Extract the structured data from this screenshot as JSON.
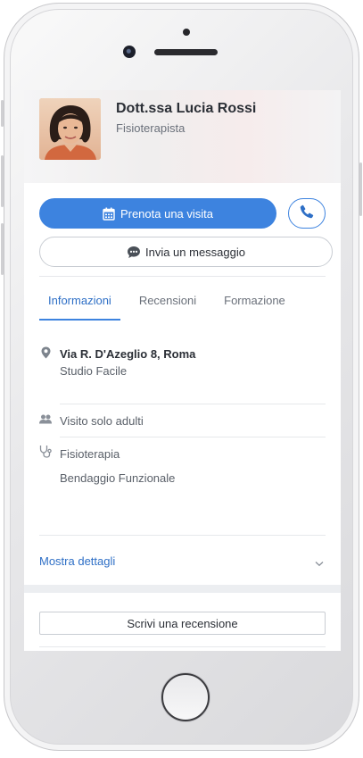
{
  "doctor": {
    "name": "Dott.ssa Lucia Rossi",
    "specialty": "Fisioterapista"
  },
  "actions": {
    "book_label": "Prenota una visita",
    "message_label": "Invia un messaggio",
    "call_icon": "phone-icon",
    "book_icon": "calendar-icon",
    "message_icon": "chat-bubble-icon"
  },
  "tabs": [
    {
      "label": "Informazioni",
      "active": true
    },
    {
      "label": "Recensioni",
      "active": false
    },
    {
      "label": "Formazione",
      "active": false
    }
  ],
  "info": {
    "address": "Via R. D'Azeglio 8, Roma",
    "clinic": "Studio Facile",
    "patients": "Visito solo adulti",
    "services": [
      "Fisioterapia",
      "Bendaggio Funzionale"
    ],
    "details_label": "Mostra dettagli"
  },
  "review": {
    "button_label": "Scrivi una recensione"
  },
  "colors": {
    "accent": "#3d83df",
    "link": "#2e6fc6",
    "text": "#2b2f36",
    "muted": "#6a707a"
  }
}
